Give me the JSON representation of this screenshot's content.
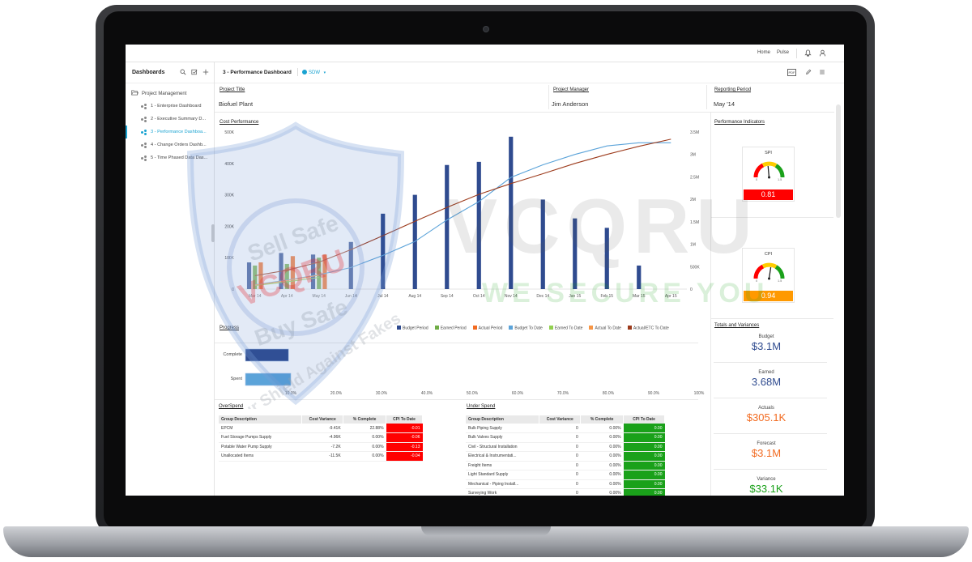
{
  "topbar": {
    "home": "Home",
    "pulse": "Pulse",
    "bell_icon": "bell-icon",
    "user_icon": "user-icon"
  },
  "sidebar": {
    "title": "Dashboards",
    "folder": "Project Management",
    "items": [
      {
        "label": "1 - Enterprise Dashboard"
      },
      {
        "label": "2 - Executive Summary D..."
      },
      {
        "label": "3 - Performance Dashboa..."
      },
      {
        "label": "4 - Change Orders Dashb..."
      },
      {
        "label": "5 - Time Phased Data Das..."
      }
    ]
  },
  "header": {
    "title": "3 - Performance Dashboard",
    "tag": "SDW",
    "pdf": "PDF"
  },
  "fields": {
    "project_title_label": "Project Title",
    "project_title": "Biofuel Plant",
    "project_manager_label": "Project Manager",
    "project_manager": "Jim Anderson",
    "reporting_period_label": "Reporting Period",
    "reporting_period": "May '14"
  },
  "cost_chart": {
    "title": "Cost Performance",
    "y_left_ticks": [
      "0",
      "100K",
      "200K",
      "300K",
      "400K",
      "500K"
    ],
    "y_right_ticks": [
      "0",
      "500K",
      "1M",
      "1.5M",
      "2M",
      "2.5M",
      "3M",
      "3.5M"
    ],
    "x_labels": [
      "Mar 14",
      "Apr 14",
      "May 14",
      "Jun 14",
      "Jul 14",
      "Aug 14",
      "Sep 14",
      "Oct 14",
      "Nov 14",
      "Dec 14",
      "Jan 15",
      "Feb 15",
      "Mar 15",
      "Apr 15"
    ],
    "legend": [
      "Budget Period",
      "Earned Period",
      "Actual Period",
      "Budget To Date",
      "Earned To Date",
      "Actual To Date",
      "Actual/ETC To Date"
    ]
  },
  "chart_data": [
    {
      "type": "bar",
      "title": "Cost Performance",
      "categories": [
        "Mar 14",
        "Apr 14",
        "May 14",
        "Jun 14",
        "Jul 14",
        "Aug 14",
        "Sep 14",
        "Oct 14",
        "Nov 14",
        "Dec 14",
        "Jan 15",
        "Feb 15",
        "Mar 15",
        "Apr 15"
      ],
      "ylim": [
        0,
        500000
      ],
      "y2lim": [
        0,
        3500000
      ],
      "series": [
        {
          "name": "Budget Period",
          "kind": "bar",
          "axis": "left",
          "color": "#2f4b8f",
          "values": [
            85000,
            115000,
            110000,
            150000,
            240000,
            300000,
            395000,
            405000,
            485000,
            285000,
            225000,
            195000,
            75000,
            null
          ]
        },
        {
          "name": "Earned Period",
          "kind": "bar",
          "axis": "left",
          "color": "#70ad47",
          "values": [
            75000,
            80000,
            100000,
            null,
            null,
            null,
            null,
            null,
            null,
            null,
            null,
            null,
            null,
            null
          ]
        },
        {
          "name": "Actual Period",
          "kind": "bar",
          "axis": "left",
          "color": "#f26b21",
          "values": [
            85000,
            105000,
            110000,
            null,
            null,
            null,
            null,
            null,
            null,
            null,
            null,
            null,
            null,
            null
          ]
        },
        {
          "name": "Budget To Date",
          "kind": "line",
          "axis": "right",
          "color": "#5ba3d9",
          "values": [
            100000,
            200000,
            320000,
            480000,
            750000,
            1060000,
            1540000,
            1950000,
            2490000,
            2770000,
            3000000,
            3190000,
            3260000,
            3260000
          ]
        },
        {
          "name": "Earned To Date",
          "kind": "line",
          "axis": "right",
          "color": "#92d050",
          "values": [
            80000,
            160000,
            260000,
            null,
            null,
            null,
            null,
            null,
            null,
            null,
            null,
            null,
            null,
            null
          ]
        },
        {
          "name": "Actual To Date",
          "kind": "line",
          "axis": "right",
          "color": "#f79646",
          "values": [
            90000,
            190000,
            310000,
            null,
            null,
            null,
            null,
            null,
            null,
            null,
            null,
            null,
            null,
            null
          ]
        },
        {
          "name": "Actual/ETC To Date",
          "kind": "line",
          "axis": "right",
          "color": "#9c3a1b",
          "values": [
            300000,
            420000,
            600000,
            880000,
            1190000,
            1510000,
            1820000,
            2110000,
            2350000,
            2570000,
            2800000,
            3000000,
            3180000,
            3340000
          ]
        }
      ]
    },
    {
      "type": "bar",
      "title": "Progress",
      "categories": [
        "Complete",
        "Spent"
      ],
      "values": [
        9.5,
        10
      ],
      "xlim": [
        0,
        100
      ],
      "x_ticks": [
        "10.0%",
        "20.0%",
        "30.0%",
        "40.0%",
        "50.0%",
        "60.0%",
        "70.0%",
        "80.0%",
        "90.0%",
        "100%"
      ]
    }
  ],
  "progress": {
    "title": "Progress",
    "bars": [
      "Complete",
      "Spent"
    ]
  },
  "indicators": {
    "title": "Performance Indicators",
    "spi": {
      "name": "SPI",
      "value": "0.81",
      "color": "#ff0000",
      "gauge_min": "0",
      "gauge_max": "1.5"
    },
    "cpi": {
      "name": "CPI",
      "value": "0.94",
      "color": "#ff9900",
      "gauge_min": "0",
      "gauge_max": "1.5"
    }
  },
  "totals": {
    "title": "Totals and Variances",
    "items": [
      {
        "label": "Budget",
        "value": "$3.1M",
        "color": "#2f4b8f"
      },
      {
        "label": "Earned",
        "value": "3.68M",
        "color": "#2f4b8f"
      },
      {
        "label": "Actuals",
        "value": "$305.1K",
        "color": "#f26b21"
      },
      {
        "label": "Forecast",
        "value": "$3.1M",
        "color": "#f26b21"
      },
      {
        "label": "Variance",
        "value": "$33.1K",
        "color": "#1aa11a"
      }
    ]
  },
  "overspend": {
    "title": "OverSpend",
    "headers": [
      "Group Description",
      "Cost Variance",
      "% Complete",
      "CPI To Date"
    ],
    "rows": [
      [
        "EPCM",
        "-9.41K",
        "22.88%",
        "-0.01"
      ],
      [
        "Fuel Storage Pumps Supply",
        "-4.96K",
        "0.00%",
        "-0.06"
      ],
      [
        "Potable Water Pump Supply",
        "-7.2K",
        "0.00%",
        "-0.13"
      ],
      [
        "Unallocated Items",
        "-11.5K",
        "0.00%",
        "-0.04"
      ]
    ]
  },
  "underspend": {
    "title": "Under Spend",
    "headers": [
      "Group Description",
      "Cost Variance",
      "% Complete",
      "CPI To Date"
    ],
    "rows": [
      [
        "Bulk Piping Supply",
        "0",
        "0.00%",
        "0.00"
      ],
      [
        "Bulk Valves Supply",
        "0",
        "0.00%",
        "0.00"
      ],
      [
        "Civil - Structural Installation",
        "0",
        "0.00%",
        "0.00"
      ],
      [
        "Electrical & Instrumentati...",
        "0",
        "0.00%",
        "0.00"
      ],
      [
        "Freight Items",
        "0",
        "0.00%",
        "0.00"
      ],
      [
        "Light Standard Supply",
        "0",
        "0.00%",
        "0.00"
      ],
      [
        "Mechanical - Piping Install...",
        "0",
        "0.00%",
        "0.00"
      ],
      [
        "Surveying Work",
        "0",
        "0.00%",
        "0.00"
      ]
    ]
  },
  "watermark": {
    "brand": "VCQRU",
    "slogan": "WE SECURE YOU",
    "shield_top": "Sell Safe",
    "shield_mid": "VCQRU",
    "shield_bot": "Buy Safe",
    "shield_arc": "Your Shield Against Fakes"
  }
}
